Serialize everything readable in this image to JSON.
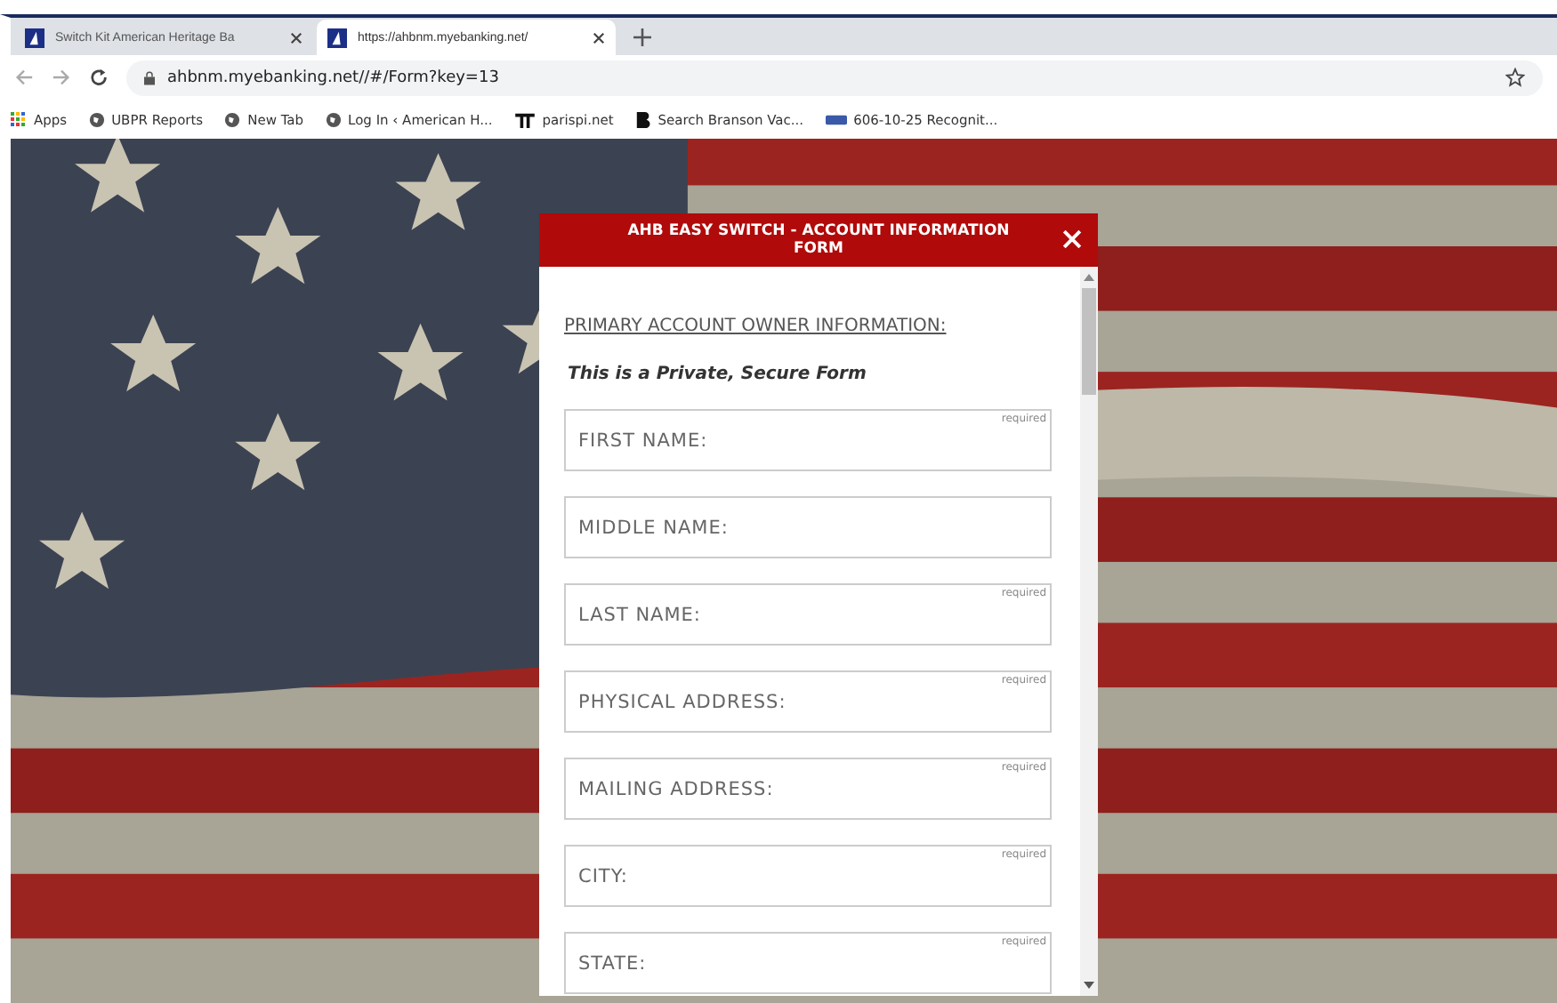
{
  "tabs": [
    {
      "title": "Switch Kit American Heritage Ba",
      "selected": false
    },
    {
      "title": "https://ahbnm.myebanking.net/",
      "selected": true
    }
  ],
  "address_bar": {
    "url": "ahbnm.myebanking.net//#/Form?key=13"
  },
  "bookmarks": [
    {
      "kind": "apps",
      "label": "Apps"
    },
    {
      "kind": "globe",
      "label": "UBPR Reports"
    },
    {
      "kind": "globe",
      "label": "New Tab"
    },
    {
      "kind": "globe",
      "label": "Log In ‹ American H..."
    },
    {
      "kind": "pi",
      "label": "parispi.net"
    },
    {
      "kind": "b",
      "label": "Search Branson Vac..."
    },
    {
      "kind": "pwr",
      "label": "606-10-25 Recognit..."
    }
  ],
  "modal": {
    "title": "AHB EASY SWITCH - ACCOUNT INFORMATION FORM",
    "section_heading": "PRIMARY ACCOUNT OWNER INFORMATION:",
    "note": "This is a Private, Secure Form",
    "fields": [
      {
        "placeholder": "FIRST NAME:",
        "required_note": "required"
      },
      {
        "placeholder": "MIDDLE NAME:"
      },
      {
        "placeholder": "LAST NAME:",
        "required_note": "required"
      },
      {
        "placeholder": "PHYSICAL ADDRESS:",
        "required_note": "required"
      },
      {
        "placeholder": "MAILING ADDRESS:",
        "required_note": "required"
      },
      {
        "placeholder": "CITY:",
        "required_note": "required"
      },
      {
        "placeholder": "STATE:",
        "required_note": "required"
      }
    ]
  }
}
